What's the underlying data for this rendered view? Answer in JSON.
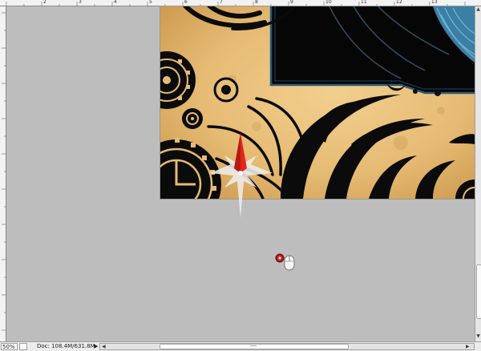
{
  "rulers": {
    "top_labels": [
      "2",
      "3",
      "4",
      "5",
      "6",
      "7",
      "8",
      "9",
      "10",
      "11",
      "12",
      "13"
    ]
  },
  "statusbar": {
    "zoom": "50%",
    "doc_size": "Doc: 108.4M/631.8M",
    "menu_arrow": "▶",
    "scroll_left_arrow": "◀",
    "scroll_right_arrow": "▶"
  },
  "scrollbar_vertical": {
    "up_arrow": "▲",
    "down_arrow": "▼"
  },
  "colors": {
    "workspace": "#bdbdbd",
    "parchment": "#e8bf7a",
    "ink": "#0b0b0b",
    "frame_blue": "#2a5a78",
    "feather_blue": "#3f86ad",
    "compass_red": "#e0261f"
  },
  "icons": {
    "compass": "compass-star-icon",
    "record": "record-icon",
    "mouse": "mouse-icon"
  }
}
